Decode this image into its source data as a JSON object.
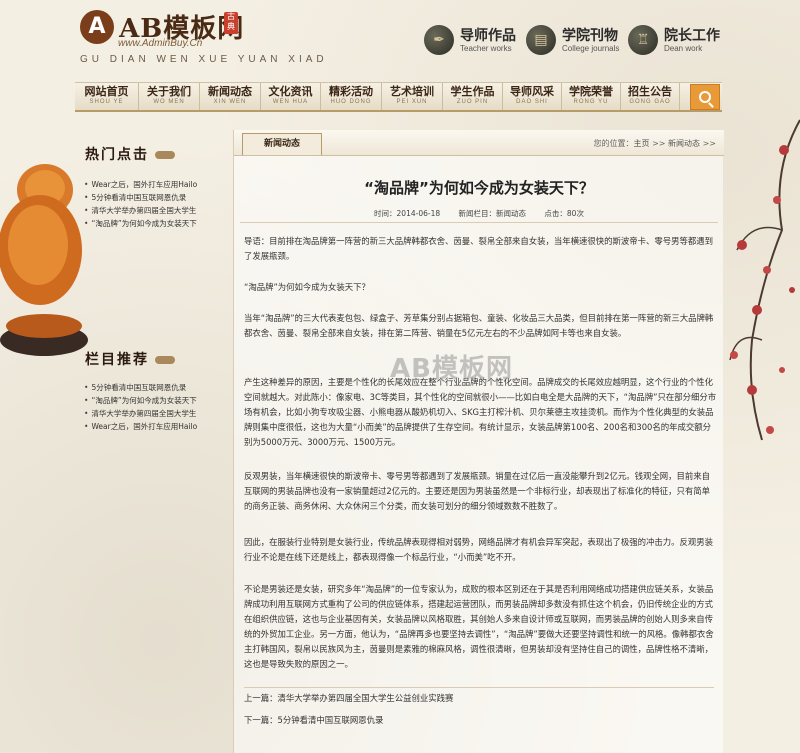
{
  "logo": {
    "mark": "A",
    "name": "AB模板网",
    "url": "www.AdminBuy.Cn",
    "subtitle": "GU DIAN WEN XUE YUAN XIAD",
    "seal": "古典"
  },
  "quick_links": [
    {
      "title": "导师作品",
      "sub": "Teacher works",
      "icon": "brush-icon"
    },
    {
      "title": "学院刊物",
      "sub": "College journals",
      "icon": "book-icon"
    },
    {
      "title": "院长工作",
      "sub": "Dean work",
      "icon": "dean-icon"
    }
  ],
  "nav": [
    {
      "label": "网站首页",
      "sub": "SHOU YE"
    },
    {
      "label": "关于我们",
      "sub": "WO MEN"
    },
    {
      "label": "新闻动态",
      "sub": "XIN WEN"
    },
    {
      "label": "文化资讯",
      "sub": "WEN HUA"
    },
    {
      "label": "精彩活动",
      "sub": "HUO DONG"
    },
    {
      "label": "艺术培训",
      "sub": "PEI XUN"
    },
    {
      "label": "学生作品",
      "sub": "ZUO PIN"
    },
    {
      "label": "导师风采",
      "sub": "DAO SHI"
    },
    {
      "label": "学院荣誉",
      "sub": "RONG YU"
    },
    {
      "label": "招生公告",
      "sub": "GONG GAO"
    }
  ],
  "sidebar": {
    "hot_title": "热门点击",
    "hot_items": [
      "Wear之后，国外打车应用Hailo",
      "5分钟看清中国互联网恩仇录",
      "清华大学举办第四届全国大学生",
      "“淘品牌”为何如今成为女装天下"
    ],
    "rec_title": "栏目推荐",
    "rec_items": [
      "5分钟看清中国互联网恩仇录",
      "“淘品牌”为何如今成为女装天下",
      "清华大学举办第四届全国大学生",
      "Wear之后，国外打车应用Hailo"
    ]
  },
  "main": {
    "tab": "新闻动态",
    "crumb_prefix": "您的位置：",
    "crumb_home": "主页",
    "crumb_sep": " >> ",
    "crumb_section": "新闻动态",
    "crumb_tail": " >>",
    "title": "“淘品牌”为何如今成为女装天下？",
    "meta_time": "时间：2014-06-18",
    "meta_section": "新闻栏目：新闻动态",
    "meta_clicks": "点击：80次",
    "paragraphs": [
      "导语：目前排在淘品牌第一阵营的新三大品牌韩都衣舍、茵曼、裂帛全部来自女装，当年横速很快的斯波帝卡、零号男等都遇到了发展瓶颈。",
      "“淘品牌”为何如今成为女装天下？",
      "当年“淘品牌”的三大代表麦包包、绿盒子、芳草集分别占据箱包、童装、化妆品三大品类，但目前排在第一阵营的新三大品牌韩都衣舍、茵曼、裂帛全部来自女装，排在第二阵营、销量在5亿元左右的不少品牌如阿卡等也来自女装。",
      "产生这种差异的原因，主要是个性化的长尾效应在整个行业品牌的个性化空间。品牌成交的长尾效应越明显，这个行业的个性化空间就越大。对此陈小：像家电、3C等类目，其个性化的空间就很小——比如白电全是大品牌的天下，“淘品牌”只在部分细分市场有机会，比如小狗专攻吸尘器、小熊电器从酸奶机切入、SKG主打榨汁机、贝尔莱德主攻挂烫机。而作为个性化典型的女装品牌则集中度很低，这也为大量“小而美”的品牌提供了生存空间。有统计显示，女装品牌第100名、200名和300名的年成交额分别为5000万元、3000万元、1500万元。",
      "反观男装，当年横速很快的斯波帝卡、零号男等都遇到了发展瓶颈。销量在过亿后一直没能攀升到2亿元。钱观全网，目前来自互联网的男装品牌也没有一家销量超过2亿元的。主要还是因为男装虽然是一个非标行业，却表现出了标准化的特征，只有简单的商务正装、商务休闲、大众休闲三个分类，而女装可划分的细分领域数数不胜数了。",
      "因此，在服装行业特别是女装行业，传统品牌表现得相对弱势，网络品牌才有机会异军突起，表现出了极强的冲击力。反观男装行业不论是在线下还是线上，都表现得像一个标品行业，“小而美”吃不开。",
      "不论是男装还是女装，研究多年“淘品牌”的一位专家认为，成败的根本区别还在于其是否利用网络成功搭建供应链关系，女装品牌成功利用互联网方式重构了公司的供应链体系，搭建起运营团队，而男装品牌却多数没有抓住这个机会，仍旧传统企业的方式在组织供应链，这也与企业基因有关，女装品牌以风格取胜，其创始人多来自设计师或互联网，而男装品牌的创始人则多来自传统的外贸加工企业。另一方面，他认为，“品牌再多也要坚持去调性”，“淘品牌”要做大还要坚持调性和统一的风格。像韩都衣舍主打韩国风，裂帛以民族风为主，茵曼则是素雅的棉麻风格，调性很清晰，但男装却没有坚持住自己的调性，品牌性格不清晰，这也是导致失败的原因之一。"
    ],
    "prev_label": "上一篇：",
    "prev_link": "清华大学举办第四届全国大学生公益创业实践赛",
    "next_label": "下一篇：",
    "next_link": "5分钟看清中国互联网恩仇录",
    "watermark": "AB模板网"
  },
  "colors": {
    "accent": "#e79a37",
    "brand_brown": "#7a3e1b",
    "blossom": "#b63a3a"
  }
}
